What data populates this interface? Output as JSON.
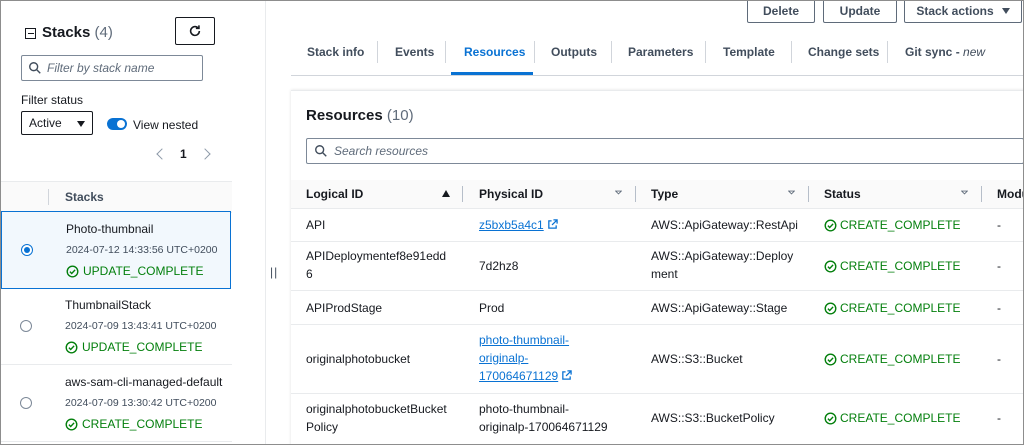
{
  "left_panel": {
    "title": "Stacks",
    "count": "(4)",
    "filter_placeholder": "Filter by stack name",
    "filter_status_label": "Filter status",
    "status_value": "Active",
    "view_nested_label": "View nested",
    "page_number": "1",
    "column_header": "Stacks",
    "stacks": [
      {
        "name": "Photo-thumbnail",
        "date": "2024-07-12 14:33:56 UTC+0200",
        "status": "UPDATE_COMPLETE"
      },
      {
        "name": "ThumbnailStack",
        "date": "2024-07-09 13:43:41 UTC+0200",
        "status": "UPDATE_COMPLETE"
      },
      {
        "name": "aws-sam-cli-managed-default",
        "date": "2024-07-09 13:30:42 UTC+0200",
        "status": "CREATE_COMPLETE"
      }
    ]
  },
  "actions": {
    "delete": "Delete",
    "update": "Update",
    "stack_actions": "Stack actions"
  },
  "tabs": {
    "stack_info": "Stack info",
    "events": "Events",
    "resources": "Resources",
    "outputs": "Outputs",
    "parameters": "Parameters",
    "template": "Template",
    "change_sets": "Change sets",
    "git_sync": "Git sync",
    "git_sync_new": "new"
  },
  "resources": {
    "title": "Resources",
    "count": "(10)",
    "search_placeholder": "Search resources",
    "columns": {
      "logical_id": "Logical ID",
      "physical_id": "Physical ID",
      "type": "Type",
      "status": "Status",
      "module": "Modu"
    },
    "rows": [
      {
        "logical_l1": "API",
        "logical_l2": "",
        "physical_l1": "z5bxb5a4c1",
        "physical_l2": "",
        "physical_l3": "",
        "type_l1": "AWS::ApiGateway::RestApi",
        "type_l2": "",
        "status": "CREATE_COMPLETE",
        "module": "-"
      },
      {
        "logical_l1": "APIDeploymentef8e91edd",
        "logical_l2": "6",
        "physical_l1": "7d2hz8",
        "physical_l2": "",
        "physical_l3": "",
        "type_l1": "AWS::ApiGateway::Deploy",
        "type_l2": "ment",
        "status": "CREATE_COMPLETE",
        "module": "-"
      },
      {
        "logical_l1": "APIProdStage",
        "logical_l2": "",
        "physical_l1": "Prod",
        "physical_l2": "",
        "physical_l3": "",
        "type_l1": "AWS::ApiGateway::Stage",
        "type_l2": "",
        "status": "CREATE_COMPLETE",
        "module": "-"
      },
      {
        "logical_l1": "originalphotobucket",
        "logical_l2": "",
        "physical_l1": "photo-thumbnail-",
        "physical_l2": "originalp-",
        "physical_l3": "170064671129",
        "type_l1": "AWS::S3::Bucket",
        "type_l2": "",
        "status": "CREATE_COMPLETE",
        "module": "-"
      },
      {
        "logical_l1": "originalphotobucketBucket",
        "logical_l2": "Policy",
        "physical_l1": "photo-thumbnail-",
        "physical_l2": "originalp-170064671129",
        "physical_l3": "",
        "type_l1": "AWS::S3::BucketPolicy",
        "type_l2": "",
        "status": "CREATE_COMPLETE",
        "module": "-"
      }
    ]
  },
  "colors": {
    "accent": "#0972d3",
    "success": "#037f0c",
    "text": "#16191f"
  }
}
